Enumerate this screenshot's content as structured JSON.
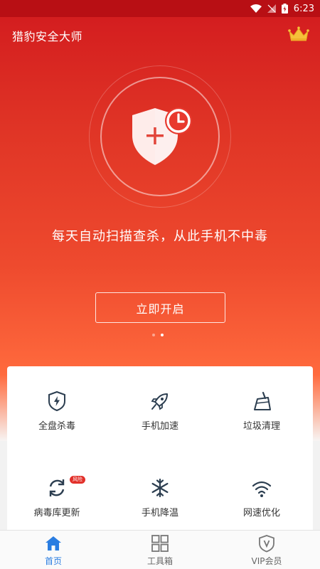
{
  "status_bar": {
    "time": "6:23"
  },
  "header": {
    "title": "猎豹安全大师",
    "vip_icon": "crown-icon"
  },
  "hero": {
    "icon": "shield-plus-clock-icon",
    "tagline": "每天自动扫描查杀，从此手机不中毒",
    "button_label": "立即开启",
    "pager": {
      "count": 2,
      "active": 2
    }
  },
  "features": [
    {
      "label": "全盘杀毒",
      "icon": "shield-bolt-icon"
    },
    {
      "label": "手机加速",
      "icon": "rocket-icon"
    },
    {
      "label": "垃圾清理",
      "icon": "broom-icon"
    },
    {
      "label": "病毒库更新",
      "icon": "refresh-icon",
      "badge": "风险"
    },
    {
      "label": "手机降温",
      "icon": "snowflake-icon"
    },
    {
      "label": "网速优化",
      "icon": "wifi-icon"
    }
  ],
  "tabs": [
    {
      "label": "首页",
      "icon": "home-icon",
      "active": true
    },
    {
      "label": "工具箱",
      "icon": "grid-icon",
      "active": false
    },
    {
      "label": "VIP会员",
      "icon": "vip-shield-icon",
      "active": false
    }
  ],
  "colors": {
    "accent": "#d21a1e",
    "tab_active": "#2a7de1"
  }
}
